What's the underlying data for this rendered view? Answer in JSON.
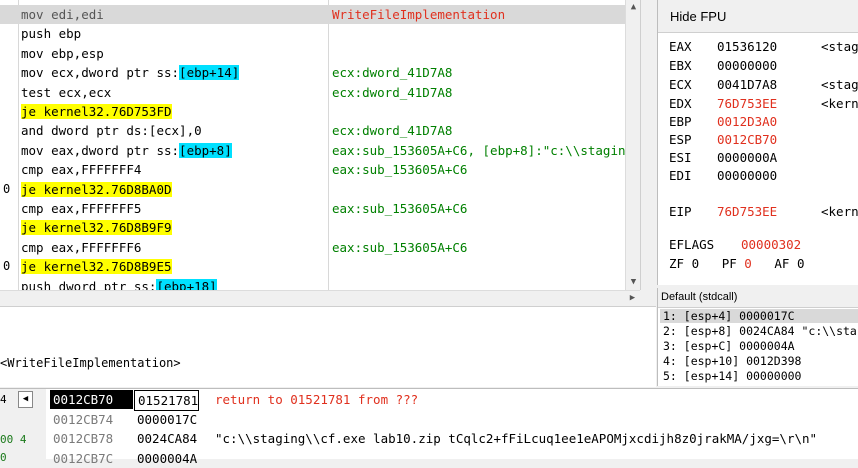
{
  "disasm": {
    "rows": [
      {
        "gutter": "",
        "parts": [
          [
            "gray",
            "mov edi,edi"
          ]
        ],
        "comment": "WriteFileImplementation",
        "comment_style": "red",
        "selected": true
      },
      {
        "gutter": "",
        "parts": [
          [
            "",
            "push ebp"
          ]
        ],
        "comment": ""
      },
      {
        "gutter": "",
        "parts": [
          [
            "",
            "mov ebp,esp"
          ]
        ],
        "comment": ""
      },
      {
        "gutter": "",
        "parts": [
          [
            "",
            "mov ecx,dword ptr ss:"
          ],
          [
            "brk",
            "[ebp+14]"
          ]
        ],
        "comment": "ecx:dword_41D7A8"
      },
      {
        "gutter": "",
        "parts": [
          [
            "",
            "test ecx,ecx"
          ]
        ],
        "comment": "ecx:dword_41D7A8"
      },
      {
        "gutter": "",
        "parts": [
          [
            "jmp",
            "je kernel32.76D753FD"
          ]
        ],
        "comment": ""
      },
      {
        "gutter": "",
        "parts": [
          [
            "",
            "and dword ptr ds:[ecx],0"
          ]
        ],
        "comment": "ecx:dword_41D7A8"
      },
      {
        "gutter": "",
        "parts": [
          [
            "",
            "mov eax,dword ptr ss:"
          ],
          [
            "brk",
            "[ebp+8]"
          ]
        ],
        "comment": "eax:sub_153605A+C6, [ebp+8]:\"c:\\\\stagin"
      },
      {
        "gutter": "",
        "parts": [
          [
            "",
            "cmp eax,FFFFFFF4"
          ]
        ],
        "comment": "eax:sub_153605A+C6"
      },
      {
        "gutter": "0",
        "parts": [
          [
            "jmp",
            "je kernel32.76D8BA0D"
          ]
        ],
        "comment": ""
      },
      {
        "gutter": "",
        "parts": [
          [
            "",
            "cmp eax,FFFFFFF5"
          ]
        ],
        "comment": "eax:sub_153605A+C6"
      },
      {
        "gutter": "",
        "parts": [
          [
            "jmp",
            "je kernel32.76D8B9F9"
          ]
        ],
        "comment": ""
      },
      {
        "gutter": "",
        "parts": [
          [
            "",
            "cmp eax,FFFFFFF6"
          ]
        ],
        "comment": "eax:sub_153605A+C6"
      },
      {
        "gutter": "0",
        "parts": [
          [
            "jmp",
            "je kernel32.76D8B9E5"
          ]
        ],
        "comment": ""
      },
      {
        "gutter": "",
        "parts": [
          [
            "",
            "push dword ptr ss:"
          ],
          [
            "brk",
            "[ebp+18]"
          ]
        ],
        "comment": ""
      }
    ]
  },
  "registers": {
    "hide_fpu_label": "Hide FPU",
    "rows": [
      {
        "name": "EAX",
        "value": "01536120",
        "changed": false,
        "comment": "<stag"
      },
      {
        "name": "EBX",
        "value": "00000000",
        "changed": false,
        "comment": ""
      },
      {
        "name": "ECX",
        "value": "0041D7A8",
        "changed": false,
        "comment": "<stag"
      },
      {
        "name": "EDX",
        "value": "76D753EE",
        "changed": true,
        "comment": "<kern"
      },
      {
        "name": "EBP",
        "value": "0012D3A0",
        "changed": true,
        "comment": ""
      },
      {
        "name": "ESP",
        "value": "0012CB70",
        "changed": true,
        "comment": ""
      },
      {
        "name": "ESI",
        "value": "0000000A",
        "changed": false,
        "comment": ""
      },
      {
        "name": "EDI",
        "value": "00000000",
        "changed": false,
        "comment": ""
      },
      {
        "name": "EIP",
        "value": "76D753EE",
        "changed": true,
        "comment": "<kern"
      }
    ],
    "eflags_label": "EFLAGS",
    "eflags_value": "00000302",
    "flags": [
      {
        "name": "ZF",
        "value": "0"
      },
      {
        "name": "PF",
        "value": "0"
      },
      {
        "name": "AF",
        "value": "0"
      }
    ]
  },
  "args": {
    "calling_convention": "Default (stdcall)",
    "rows": [
      "1: [esp+4] 0000017C",
      "2: [esp+8] 0024CA84 \"c:\\\\sta",
      "3: [esp+C] 0000004A",
      "4: [esp+10] 0012D398",
      "5: [esp+14] 00000000"
    ]
  },
  "info": {
    "text": "<WriteFileImplementation>"
  },
  "stack": {
    "left_tab_labels": [
      "4",
      "00 4",
      "0"
    ],
    "rows": [
      {
        "address": "0012CB70",
        "value": "01521781",
        "comment": "return to 01521781 from ???",
        "current": true
      },
      {
        "address": "0012CB74",
        "value": "0000017C",
        "comment": ""
      },
      {
        "address": "0012CB78",
        "value": "0024CA84",
        "comment": "\"c:\\\\staging\\\\cf.exe lab10.zip tCqlc2+fFiLcuq1ee1eAPOMjxcdijh8z0jrakMA/jxg=\\r\\n\""
      },
      {
        "address": "0012CB7C",
        "value": "0000004A",
        "comment": ""
      }
    ]
  },
  "colors": {
    "changed_register": "#e0301e",
    "jump_highlight": "#ffff00",
    "bracket_highlight": "#00e0ff",
    "comment_green": "#008000"
  }
}
